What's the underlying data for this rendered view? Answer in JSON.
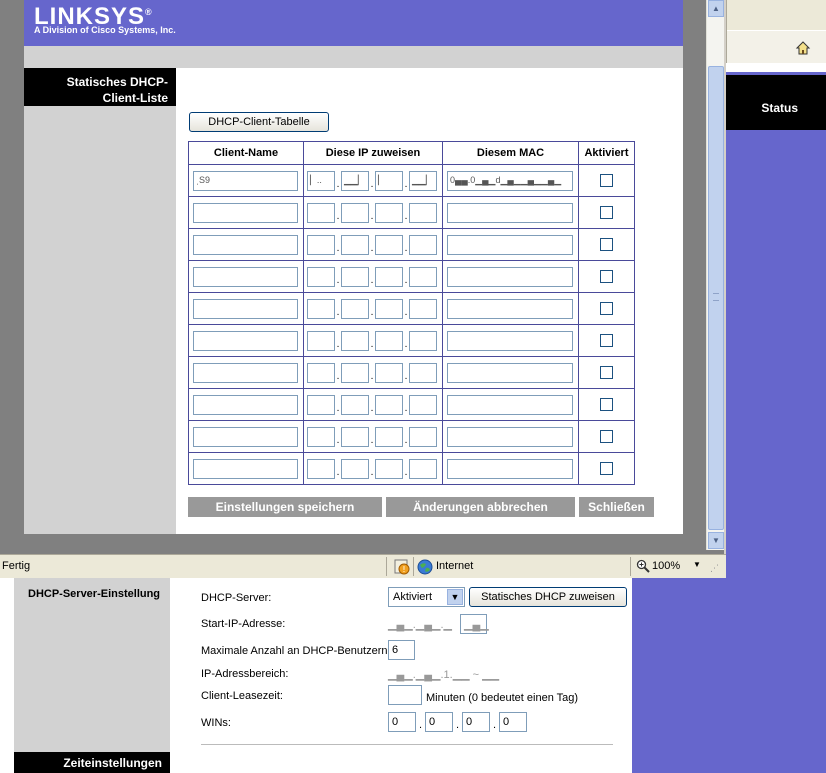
{
  "popup": {
    "logo": "LINKSYS",
    "logo_reg": "®",
    "logo_subtitle": "A Division of Cisco Systems, Inc.",
    "side_title": "Statisches DHCP-Client-Liste",
    "tab_button": "DHCP-Client-Tabelle",
    "table": {
      "headers": [
        "Client-Name",
        "Diese IP zuweisen",
        "Diesem MAC",
        "Aktiviert"
      ],
      "first_row": {
        "name": "ˌS9",
        "ip": [
          "▏..",
          "▁▁▏",
          "▏",
          "▁▁▏"
        ],
        "mac": "0▄▄.0▁▄▁d▁▄▁▁▄▁▁▄▁"
      }
    },
    "buttons": {
      "save": "Einstellungen speichern",
      "cancel": "Änderungen abbrechen",
      "close": "Schließen"
    },
    "statusbar": {
      "text": "Fertig",
      "zone": "Internet",
      "zoom": "100%"
    }
  },
  "background": {
    "status_label": "Status",
    "section_title": "DHCP-Server-Einstellung",
    "footer_title": "Zeiteinstellungen",
    "rows": {
      "dhcp_server_label": "DHCP-Server:",
      "dhcp_server_value": "Aktiviert",
      "static_button": "Statisches DHCP zuweisen",
      "start_ip_label": "Start-IP-Adresse:",
      "start_ip_value": "▁▄▁.▁▄▁.▁",
      "start_ip_last": "▁▄▁",
      "max_users_label": "Maximale Anzahl an DHCP-Benutzern:",
      "max_users_value": "6",
      "range_label": "IP-Adressbereich:",
      "range_value": "▁▄▁.▁▄▁.1.▁▁ ~ ▁▁",
      "lease_label": "Client-Leasezeit:",
      "lease_hint": "Minuten (0 bedeutet einen Tag)",
      "wins_label": "WINs:",
      "wins": [
        "0",
        "0",
        "0",
        "0"
      ]
    }
  }
}
